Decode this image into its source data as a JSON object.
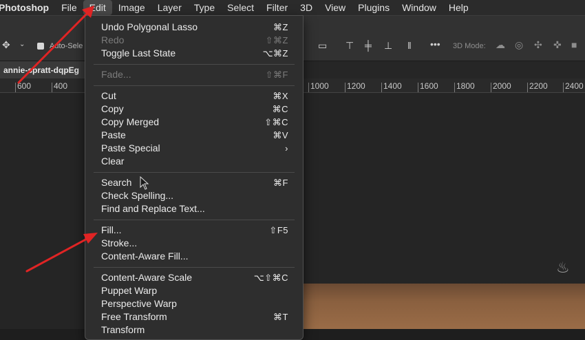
{
  "menubar": {
    "items": [
      "Photoshop",
      "File",
      "Edit",
      "Image",
      "Layer",
      "Type",
      "Select",
      "Filter",
      "3D",
      "View",
      "Plugins",
      "Window",
      "Help"
    ]
  },
  "toolbar": {
    "auto_select_label": "Auto-Sele",
    "mode_3d_label": "3D Mode:"
  },
  "document_tab": {
    "title": "annie-spratt-dqpEg"
  },
  "ruler": {
    "ticks_left": [
      "600",
      "400"
    ],
    "ticks_right": [
      "1000",
      "1200",
      "1400",
      "1600",
      "1800",
      "2000",
      "2200",
      "2400"
    ]
  },
  "edit_menu": {
    "groups": [
      [
        {
          "label": "Undo Polygonal Lasso",
          "shortcut": "⌘Z",
          "enabled": true
        },
        {
          "label": "Redo",
          "shortcut": "⇧⌘Z",
          "enabled": false
        },
        {
          "label": "Toggle Last State",
          "shortcut": "⌥⌘Z",
          "enabled": true
        }
      ],
      [
        {
          "label": "Fade...",
          "shortcut": "⇧⌘F",
          "enabled": false
        }
      ],
      [
        {
          "label": "Cut",
          "shortcut": "⌘X",
          "enabled": true
        },
        {
          "label": "Copy",
          "shortcut": "⌘C",
          "enabled": true
        },
        {
          "label": "Copy Merged",
          "shortcut": "⇧⌘C",
          "enabled": true
        },
        {
          "label": "Paste",
          "shortcut": "⌘V",
          "enabled": true
        },
        {
          "label": "Paste Special",
          "shortcut": "›",
          "enabled": true
        },
        {
          "label": "Clear",
          "shortcut": "",
          "enabled": true
        }
      ],
      [
        {
          "label": "Search",
          "shortcut": "⌘F",
          "enabled": true
        },
        {
          "label": "Check Spelling...",
          "shortcut": "",
          "enabled": true
        },
        {
          "label": "Find and Replace Text...",
          "shortcut": "",
          "enabled": true
        }
      ],
      [
        {
          "label": "Fill...",
          "shortcut": "⇧F5",
          "enabled": true
        },
        {
          "label": "Stroke...",
          "shortcut": "",
          "enabled": true
        },
        {
          "label": "Content-Aware Fill...",
          "shortcut": "",
          "enabled": true
        }
      ],
      [
        {
          "label": "Content-Aware Scale",
          "shortcut": "⌥⇧⌘C",
          "enabled": true
        },
        {
          "label": "Puppet Warp",
          "shortcut": "",
          "enabled": true
        },
        {
          "label": "Perspective Warp",
          "shortcut": "",
          "enabled": true
        },
        {
          "label": "Free Transform",
          "shortcut": "⌘T",
          "enabled": true
        },
        {
          "label": "Transform",
          "shortcut": "",
          "enabled": true
        }
      ]
    ]
  },
  "annotation_color": "#e02424"
}
